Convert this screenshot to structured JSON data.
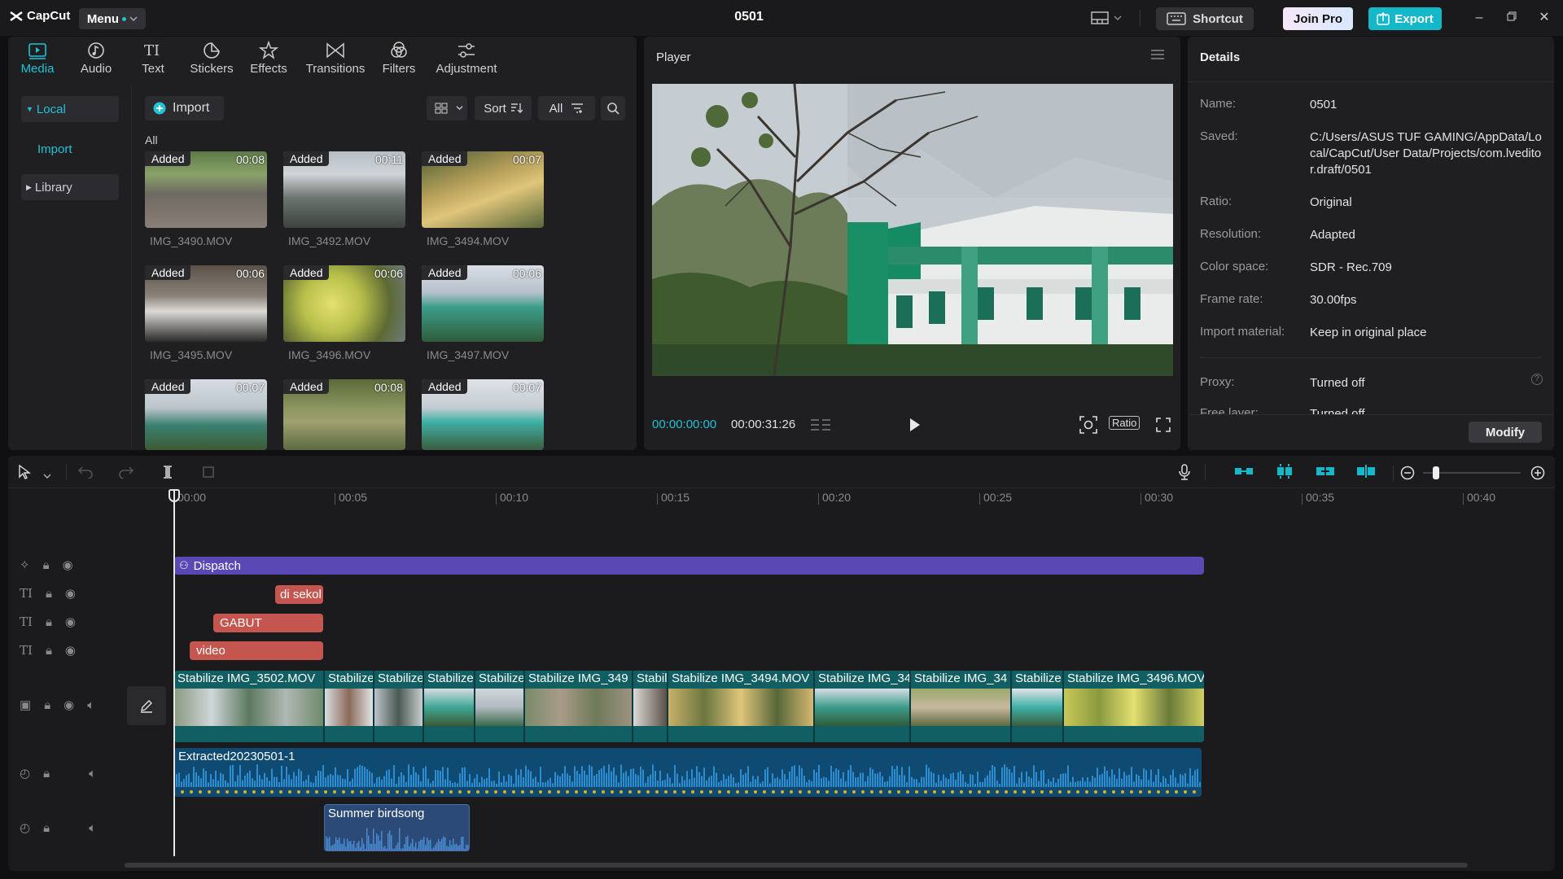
{
  "app": {
    "logo_text": "CapCut",
    "menu_label": "Menu",
    "project_title": "0501"
  },
  "header": {
    "shortcut_label": "Shortcut",
    "join_pro_label": "Join Pro",
    "export_label": "Export"
  },
  "tool_tabs": [
    {
      "label": "Media",
      "icon": "media-icon",
      "active": true
    },
    {
      "label": "Audio",
      "icon": "audio-icon"
    },
    {
      "label": "Text",
      "icon": "text-icon"
    },
    {
      "label": "Stickers",
      "icon": "sticker-icon"
    },
    {
      "label": "Effects",
      "icon": "effects-icon"
    },
    {
      "label": "Transitions",
      "icon": "transitions-icon"
    },
    {
      "label": "Filters",
      "icon": "filters-icon"
    },
    {
      "label": "Adjustment",
      "icon": "adjustment-icon"
    }
  ],
  "media_nav": {
    "local": "Local",
    "import": "Import",
    "library": "Library"
  },
  "media_toolbar": {
    "import_label": "Import",
    "sort_label": "Sort",
    "all_label": "All"
  },
  "media_section_label": "All",
  "media_items": [
    {
      "name": "IMG_3490.MOV",
      "duration": "00:08",
      "badge": "Added"
    },
    {
      "name": "IMG_3492.MOV",
      "duration": "00:11",
      "badge": "Added"
    },
    {
      "name": "IMG_3494.MOV",
      "duration": "00:07",
      "badge": "Added"
    },
    {
      "name": "IMG_3495.MOV",
      "duration": "00:06",
      "badge": "Added"
    },
    {
      "name": "IMG_3496.MOV",
      "duration": "00:06",
      "badge": "Added"
    },
    {
      "name": "IMG_3497.MOV",
      "duration": "00:06",
      "badge": "Added"
    },
    {
      "name": "",
      "duration": "00:07",
      "badge": "Added"
    },
    {
      "name": "",
      "duration": "00:08",
      "badge": "Added"
    },
    {
      "name": "",
      "duration": "00:07",
      "badge": "Added"
    }
  ],
  "player": {
    "title": "Player",
    "current_time": "00:00:00:00",
    "total_time": "00:00:31:26",
    "ratio_label": "Ratio"
  },
  "details": {
    "title": "Details",
    "rows": [
      {
        "label": "Name:",
        "value": "0501"
      },
      {
        "label": "Saved:",
        "value": "C:/Users/ASUS TUF GAMING/AppData/Local/CapCut/User Data/Projects/com.lveditor.draft/0501"
      },
      {
        "label": "Ratio:",
        "value": "Original"
      },
      {
        "label": "Resolution:",
        "value": "Adapted"
      },
      {
        "label": "Color space:",
        "value": "SDR - Rec.709"
      },
      {
        "label": "Frame rate:",
        "value": "30.00fps"
      },
      {
        "label": "Import material:",
        "value": "Keep in original place"
      },
      {
        "label": "Proxy:",
        "value": "Turned off"
      },
      {
        "label": "Free layer:",
        "value": "Turned off"
      }
    ],
    "modify_label": "Modify"
  },
  "timeline": {
    "ticks": [
      "00:00",
      "00:05",
      "00:10",
      "00:15",
      "00:20",
      "00:25",
      "00:30",
      "00:35",
      "00:40"
    ],
    "effect_clip": "Dispatch",
    "text_clips": [
      "di sekol",
      "GABUT",
      "video"
    ],
    "video_segments": [
      {
        "label": "Stabilize  IMG_3502.MOV"
      },
      {
        "label": "Stabilize"
      },
      {
        "label": "Stabilize"
      },
      {
        "label": "Stabilize"
      },
      {
        "label": "Stabilize"
      },
      {
        "label": "Stabilize  IMG_349"
      },
      {
        "label": "Stabil"
      },
      {
        "label": "Stabilize  IMG_3494.MOV"
      },
      {
        "label": "Stabilize  IMG_34"
      },
      {
        "label": "Stabilize  IMG_34"
      },
      {
        "label": "Stabilize"
      },
      {
        "label": "Stabilize  IMG_3496.MOV"
      }
    ],
    "audio_clip": "Extracted20230501-1",
    "music_clip": "Summer birdsong"
  },
  "colors": {
    "accent": "#20c2d4",
    "effect_clip": "#5a48b4",
    "text_clip": "#c4564f",
    "video_clip": "#0f5c60",
    "audio_clip": "#0f4a72"
  }
}
